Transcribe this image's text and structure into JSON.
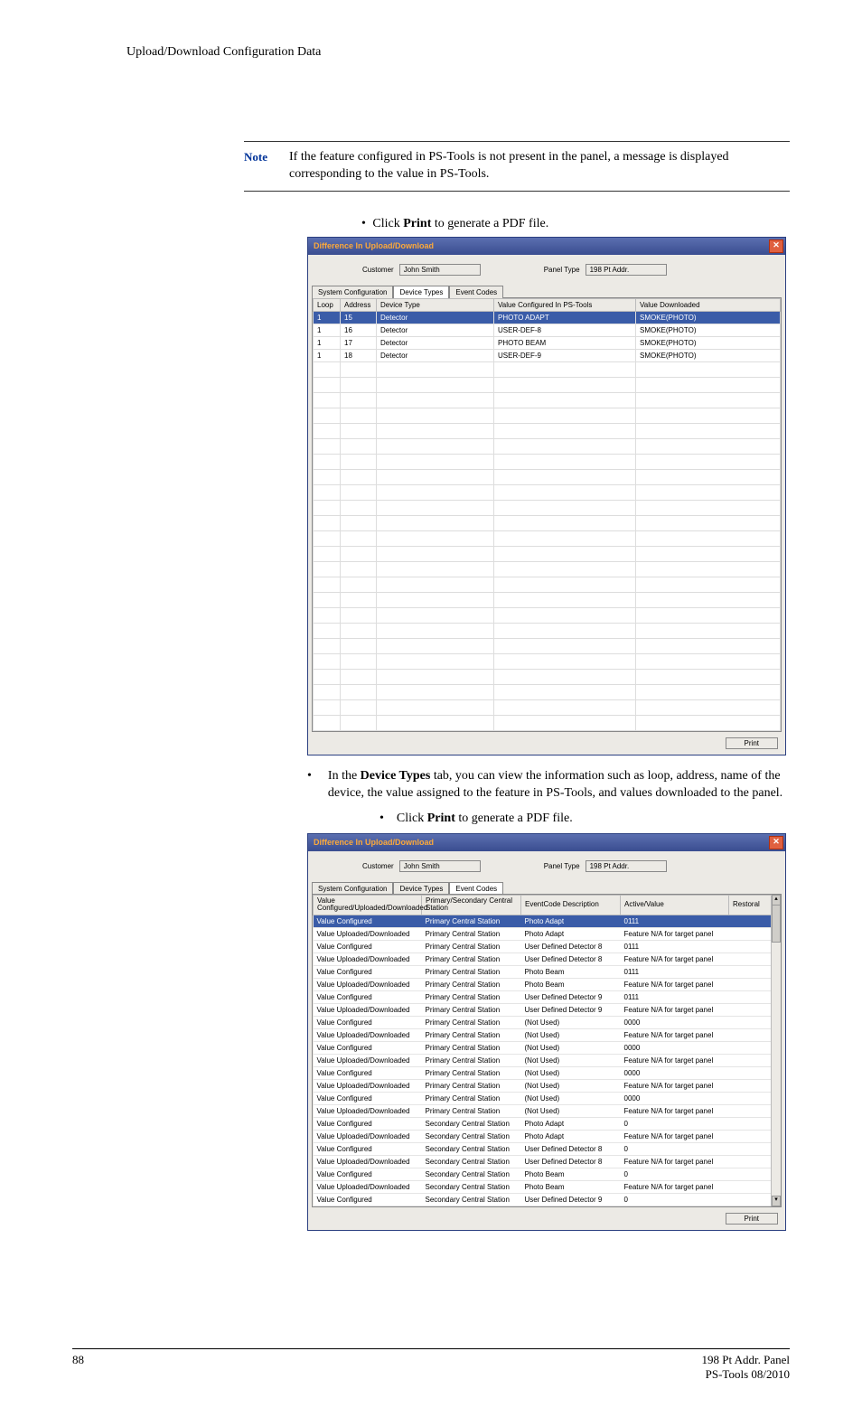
{
  "header": {
    "title": "Upload/Download Configuration Data"
  },
  "note": {
    "label": "Note",
    "text_pre": "If the feature configured in PS-Tools is not present in the panel, a message is displayed corresponding to the value in PS-Tools."
  },
  "instr1_pre": "Click ",
  "instr1_bold": "Print",
  "instr1_post": " to generate a PDF file.",
  "dlg": {
    "title": "Difference In Upload/Download",
    "customer_label": "Customer",
    "customer_value": "John Smith",
    "paneltype_label": "Panel Type",
    "paneltype_value": "198 Pt Addr.",
    "tabs": [
      "System Configuration",
      "Device Types",
      "Event Codes"
    ],
    "print_label": "Print"
  },
  "grid1": {
    "cols": [
      "Loop",
      "Address",
      "Device Type",
      "Value Configured In PS-Tools",
      "Value Downloaded"
    ],
    "rows": [
      [
        "1",
        "15",
        "Detector",
        "PHOTO ADAPT",
        "SMOKE(PHOTO)"
      ],
      [
        "1",
        "16",
        "Detector",
        "USER-DEF-8",
        "SMOKE(PHOTO)"
      ],
      [
        "1",
        "17",
        "Detector",
        "PHOTO BEAM",
        "SMOKE(PHOTO)"
      ],
      [
        "1",
        "18",
        "Detector",
        "USER-DEF-9",
        "SMOKE(PHOTO)"
      ]
    ],
    "empty_rows": 24
  },
  "para1_pre": "In the ",
  "para1_bold": "Device Types",
  "para1_post": " tab, you can view the information such as loop, address, name of the device, the value assigned to the feature in PS-Tools, and values downloaded to the panel.",
  "instr2_pre": "Click ",
  "instr2_bold": "Print",
  "instr2_post": " to generate a PDF file.",
  "grid2": {
    "cols": [
      "Value Configured/Uploaded/Downloaded",
      "Primary/Secondary Central Station",
      "EventCode Description",
      "Active/Value",
      "Restoral"
    ],
    "rows": [
      [
        "Value Configured",
        "Primary Central Station",
        "Photo Adapt",
        "0111",
        ""
      ],
      [
        "Value Uploaded/Downloaded",
        "Primary Central Station",
        "Photo Adapt",
        "Feature N/A for target panel",
        ""
      ],
      [
        "Value Configured",
        "Primary Central Station",
        "User Defined Detector 8",
        "0111",
        ""
      ],
      [
        "Value Uploaded/Downloaded",
        "Primary Central Station",
        "User Defined Detector 8",
        "Feature N/A for target panel",
        ""
      ],
      [
        "Value Configured",
        "Primary Central Station",
        "Photo Beam",
        "0111",
        ""
      ],
      [
        "Value Uploaded/Downloaded",
        "Primary Central Station",
        "Photo Beam",
        "Feature N/A for target panel",
        ""
      ],
      [
        "Value Configured",
        "Primary Central Station",
        "User Defined Detector 9",
        "0111",
        ""
      ],
      [
        "Value Uploaded/Downloaded",
        "Primary Central Station",
        "User Defined Detector 9",
        "Feature N/A for target panel",
        ""
      ],
      [
        "Value Configured",
        "Primary Central Station",
        "(Not Used)",
        "0000",
        ""
      ],
      [
        "Value Uploaded/Downloaded",
        "Primary Central Station",
        "(Not Used)",
        "Feature N/A for target panel",
        ""
      ],
      [
        "Value Configured",
        "Primary Central Station",
        "(Not Used)",
        "0000",
        ""
      ],
      [
        "Value Uploaded/Downloaded",
        "Primary Central Station",
        "(Not Used)",
        "Feature N/A for target panel",
        ""
      ],
      [
        "Value Configured",
        "Primary Central Station",
        "(Not Used)",
        "0000",
        ""
      ],
      [
        "Value Uploaded/Downloaded",
        "Primary Central Station",
        "(Not Used)",
        "Feature N/A for target panel",
        ""
      ],
      [
        "Value Configured",
        "Primary Central Station",
        "(Not Used)",
        "0000",
        ""
      ],
      [
        "Value Uploaded/Downloaded",
        "Primary Central Station",
        "(Not Used)",
        "Feature N/A for target panel",
        ""
      ],
      [
        "Value Configured",
        "Secondary Central Station",
        "Photo Adapt",
        "0",
        ""
      ],
      [
        "Value Uploaded/Downloaded",
        "Secondary Central Station",
        "Photo Adapt",
        "Feature N/A for target panel",
        ""
      ],
      [
        "Value Configured",
        "Secondary Central Station",
        "User Defined Detector 8",
        "0",
        ""
      ],
      [
        "Value Uploaded/Downloaded",
        "Secondary Central Station",
        "User Defined Detector 8",
        "Feature N/A for target panel",
        ""
      ],
      [
        "Value Configured",
        "Secondary Central Station",
        "Photo Beam",
        "0",
        ""
      ],
      [
        "Value Uploaded/Downloaded",
        "Secondary Central Station",
        "Photo Beam",
        "Feature N/A for target panel",
        ""
      ],
      [
        "Value Configured",
        "Secondary Central Station",
        "User Defined Detector 9",
        "0",
        ""
      ]
    ]
  },
  "footer": {
    "page": "88",
    "right1": "198 Pt Addr. Panel",
    "right2": "PS-Tools  08/2010"
  }
}
